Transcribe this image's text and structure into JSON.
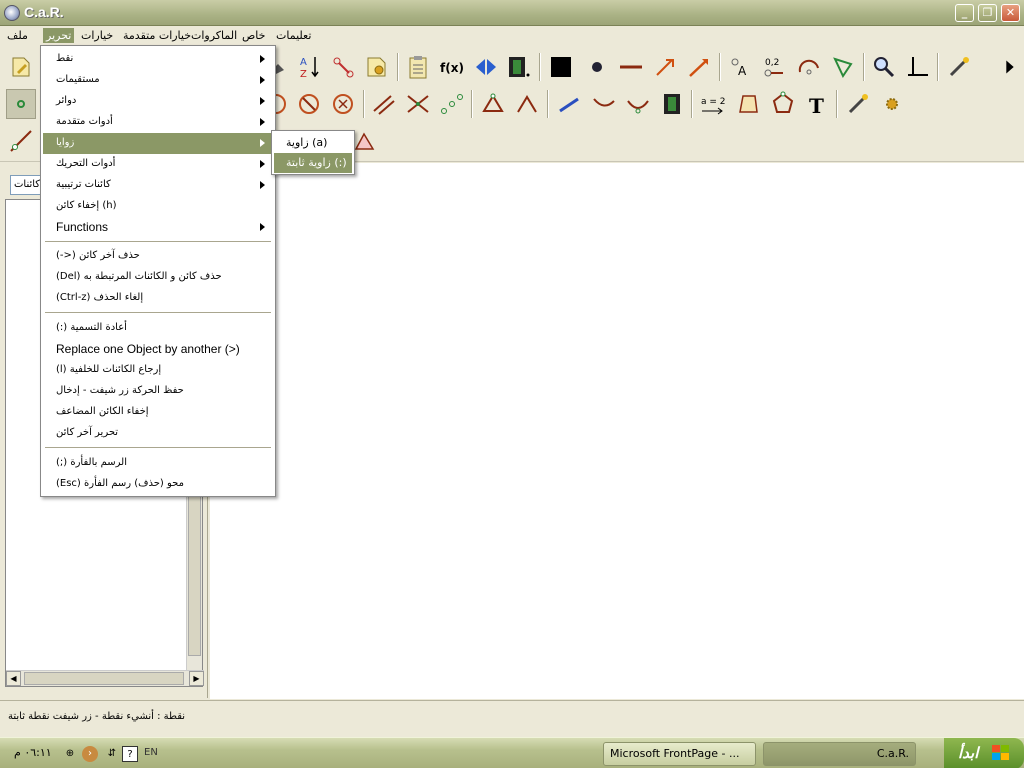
{
  "window": {
    "title": "C.a.R."
  },
  "menubar": {
    "items": [
      "ملف",
      "تحرير",
      "خيارات",
      "خيارات متقدمة",
      "الماكروات",
      "خاص",
      "تعليمات"
    ]
  },
  "objects_panel": {
    "combo_value": "كائنات"
  },
  "edit_menu": {
    "items": [
      {
        "label": "نقط",
        "submenu": true
      },
      {
        "label": "مستقيمات",
        "submenu": true
      },
      {
        "label": "دوائر",
        "submenu": true
      },
      {
        "label": "أدوات متقدمة",
        "submenu": true
      },
      {
        "label": "زوايا",
        "submenu": true
      },
      {
        "label": "أدوات التحريك",
        "submenu": true
      },
      {
        "label": "كائنات ترتيبية",
        "submenu": true
      },
      {
        "label": "إخفاء كائن (h)",
        "submenu": false
      },
      {
        "label": "Functions",
        "submenu": true
      },
      {
        "label": "(->)     حذف آخر كائن",
        "submenu": false
      },
      {
        "label": "(Del) حذف كائن و الكائنات المرتبطة به",
        "submenu": false
      },
      {
        "label": "(Ctrl-z)          إلغاء الحذف",
        "submenu": false
      },
      {
        "label": "(:) أعادة التسمية",
        "submenu": false
      },
      {
        "label": "Replace one Object by another (>)",
        "submenu": false
      },
      {
        "label": "(l) إرجاع الكائنات للخلفية",
        "submenu": false
      },
      {
        "label": "حفظ الحركة زر شيفت - إدخال",
        "submenu": false
      },
      {
        "label": "إخفاء الكائن المضاعف",
        "submenu": false
      },
      {
        "label": "تحرير آخر كائن",
        "submenu": false
      },
      {
        "label": "(;) الرسم بالفأرة",
        "submenu": false
      },
      {
        "label": "(Esc)     محو (حذف) رسم الفأرة",
        "submenu": false
      }
    ]
  },
  "angles_submenu": {
    "items": [
      "زاوية (a)",
      "زاوية ثابتة (:)"
    ]
  },
  "toolbar": {
    "fx_label": "f(x)",
    "coord_label": "0,2",
    "eq_label": "a = 2",
    "text_label": "T",
    "point_label": "A",
    "sort_top": "A",
    "sort_bottom": "Z"
  },
  "statusbar": {
    "text": "نقطة : أنشيء نقطة - زر شيفت نقطة ثابتة"
  },
  "taskbar": {
    "start_label": "ابدأ",
    "clock": "٠٦:١١ م",
    "lang": "EN",
    "tasks": [
      "Microsoft FrontPage - ...",
      "C.a.R."
    ]
  },
  "colors": {
    "highlight": "#8b9866",
    "canvas": "#ffffff",
    "toolbar_bg": "#ece9d8"
  }
}
